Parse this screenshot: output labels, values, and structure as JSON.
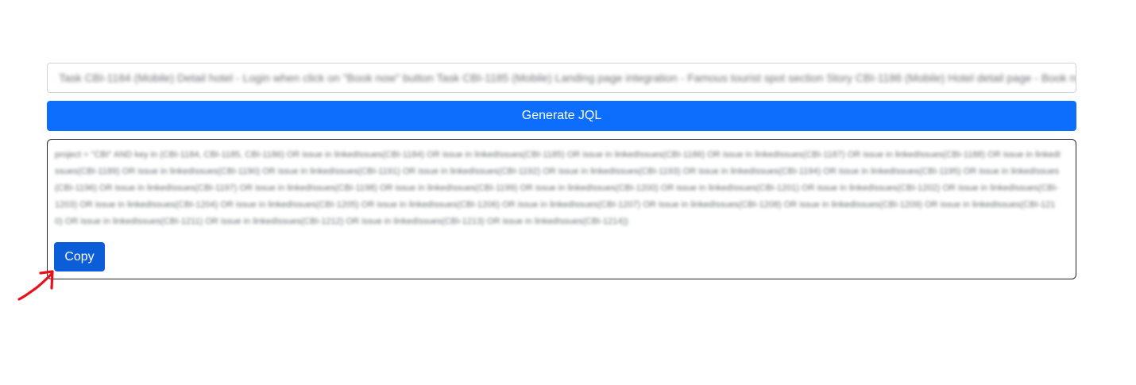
{
  "input": {
    "value": "Task CBI-1184 (Mobile) Detail hotel - Login when click on \"Book now\" button Task CBI-1185 (Mobile) Landing page integration - Famous tourist spot section Story CBI-1186 (Mobile) Hotel detail page - Book now button"
  },
  "generate_button": {
    "label": "Generate JQL",
    "color": "#0d6efd"
  },
  "output": {
    "text": "project = \"CBI\" AND key in (CBI-1184, CBI-1185, CBI-1186) OR issue in linkedIssues(CBI-1184) OR issue in linkedIssues(CBI-1185) OR issue in linkedIssues(CBI-1186) OR issue in linkedIssues(CBI-1187) OR issue in linkedIssues(CBI-1188) OR issue in linkedIssues(CBI-1189) OR issue in linkedIssues(CBI-1190) OR issue in linkedIssues(CBI-1191) OR issue in linkedIssues(CBI-1192) OR issue in linkedIssues(CBI-1193) OR issue in linkedIssues(CBI-1194) OR issue in linkedIssues(CBI-1195) OR issue in linkedIssues(CBI-1196) OR issue in linkedIssues(CBI-1197) OR issue in linkedIssues(CBI-1198) OR issue in linkedIssues(CBI-1199) OR issue in linkedIssues(CBI-1200) OR issue in linkedIssues(CBI-1201) OR issue in linkedIssues(CBI-1202) OR issue in linkedIssues(CBI-1203) OR issue in linkedIssues(CBI-1204) OR issue in linkedIssues(CBI-1205) OR issue in linkedIssues(CBI-1206) OR issue in linkedIssues(CBI-1207) OR issue in linkedIssues(CBI-1208) OR issue in linkedIssues(CBI-1209) OR issue in linkedIssues(CBI-1210) OR issue in linkedIssues(CBI-1211) OR issue in linkedIssues(CBI-1212) OR issue in linkedIssues(CBI-1213) OR issue in linkedIssues(CBI-1214))"
  },
  "copy_button": {
    "label": "Copy",
    "color": "#0b5ed7"
  },
  "annotation": {
    "icon": "red-arrow-icon",
    "color": "#e8101a"
  }
}
